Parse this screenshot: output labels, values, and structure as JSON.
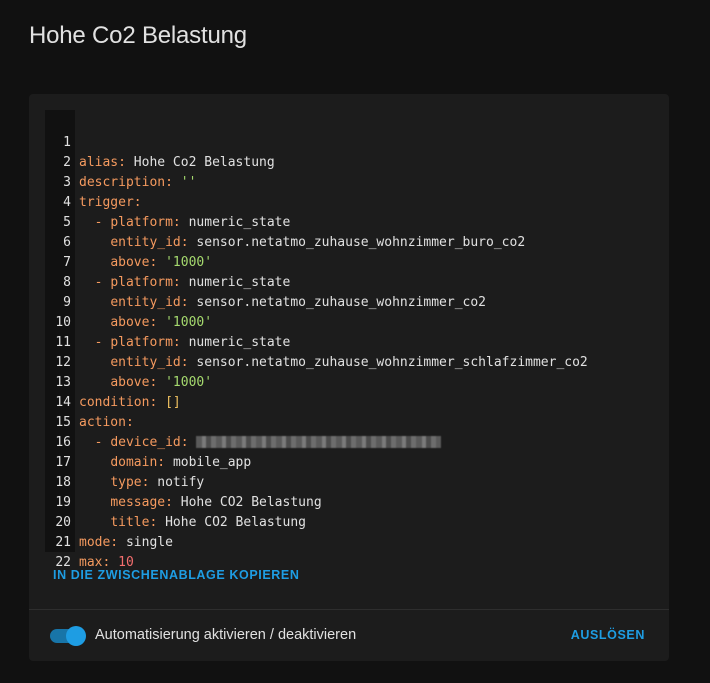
{
  "page": {
    "title": "Hohe Co2 Belastung"
  },
  "yaml": {
    "line_numbers": [
      "1",
      "2",
      "3",
      "4",
      "5",
      "6",
      "7",
      "8",
      "9",
      "10",
      "11",
      "12",
      "13",
      "14",
      "15",
      "16",
      "17",
      "18",
      "19",
      "20",
      "21",
      "22"
    ],
    "alias_key": "alias:",
    "alias_val": "Hohe Co2 Belastung",
    "description_key": "description:",
    "description_val": "''",
    "trigger_key": "trigger:",
    "dash": "-",
    "platform_key": "platform:",
    "platform_val": "numeric_state",
    "entity_key": "entity_id:",
    "entity_1": "sensor.netatmo_zuhause_wohnzimmer_buro_co2",
    "entity_2": "sensor.netatmo_zuhause_wohnzimmer_co2",
    "entity_3": "sensor.netatmo_zuhause_wohnzimmer_schlafzimmer_co2",
    "above_key": "above:",
    "above_val": "'1000'",
    "condition_key": "condition:",
    "condition_val": "[]",
    "action_key": "action:",
    "device_key": "device_id:",
    "domain_key": "domain:",
    "domain_val": "mobile_app",
    "type_key": "type:",
    "type_val": "notify",
    "message_key": "message:",
    "message_val": "Hohe CO2 Belastung",
    "title_key": "title:",
    "title_val": "Hohe CO2 Belastung",
    "mode_key": "mode:",
    "mode_val": "single",
    "max_key": "max:",
    "max_val": "10"
  },
  "actions": {
    "copy_label": "IN DIE ZWISCHENABLAGE KOPIEREN",
    "toggle_label": "Automatisierung aktivieren / deaktivieren",
    "toggle_on": true,
    "trigger_label": "AUSLÖSEN"
  },
  "colors": {
    "accent": "#1e9de3",
    "yaml_key": "#f59a5f",
    "yaml_string": "#a5d96e",
    "yaml_number": "#f36e6e",
    "yaml_bracket": "#f0c160"
  }
}
